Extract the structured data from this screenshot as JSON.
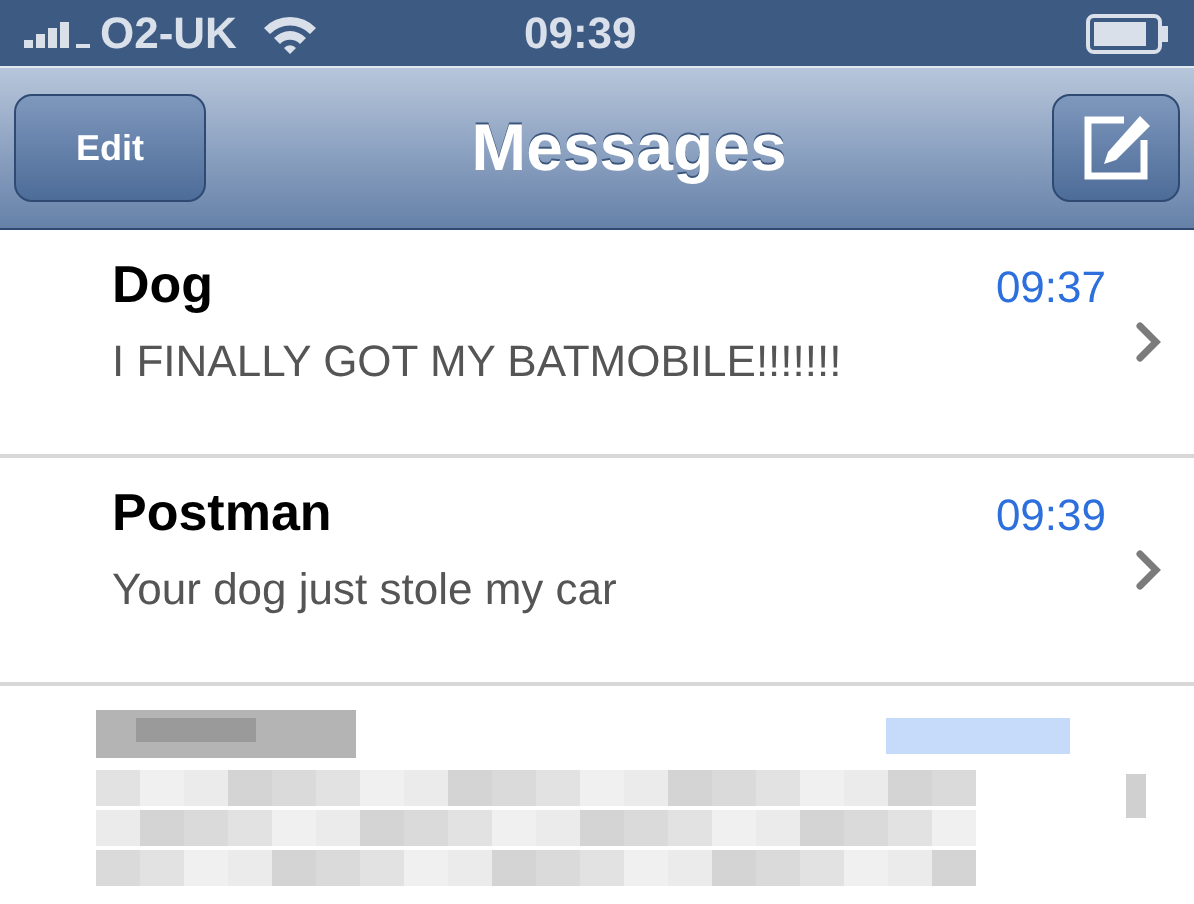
{
  "status_bar": {
    "carrier": "O2-UK",
    "time": "09:39"
  },
  "nav_bar": {
    "left_button": "Edit",
    "title": "Messages"
  },
  "conversations": [
    {
      "kind": "message",
      "name": "Dog",
      "time": "09:37",
      "preview": "I FINALLY GOT MY BATMOBILE!!!!!!!"
    },
    {
      "kind": "message",
      "name": "Postman",
      "time": "09:39",
      "preview": "Your dog just stole my car"
    },
    {
      "kind": "blurred"
    }
  ]
}
